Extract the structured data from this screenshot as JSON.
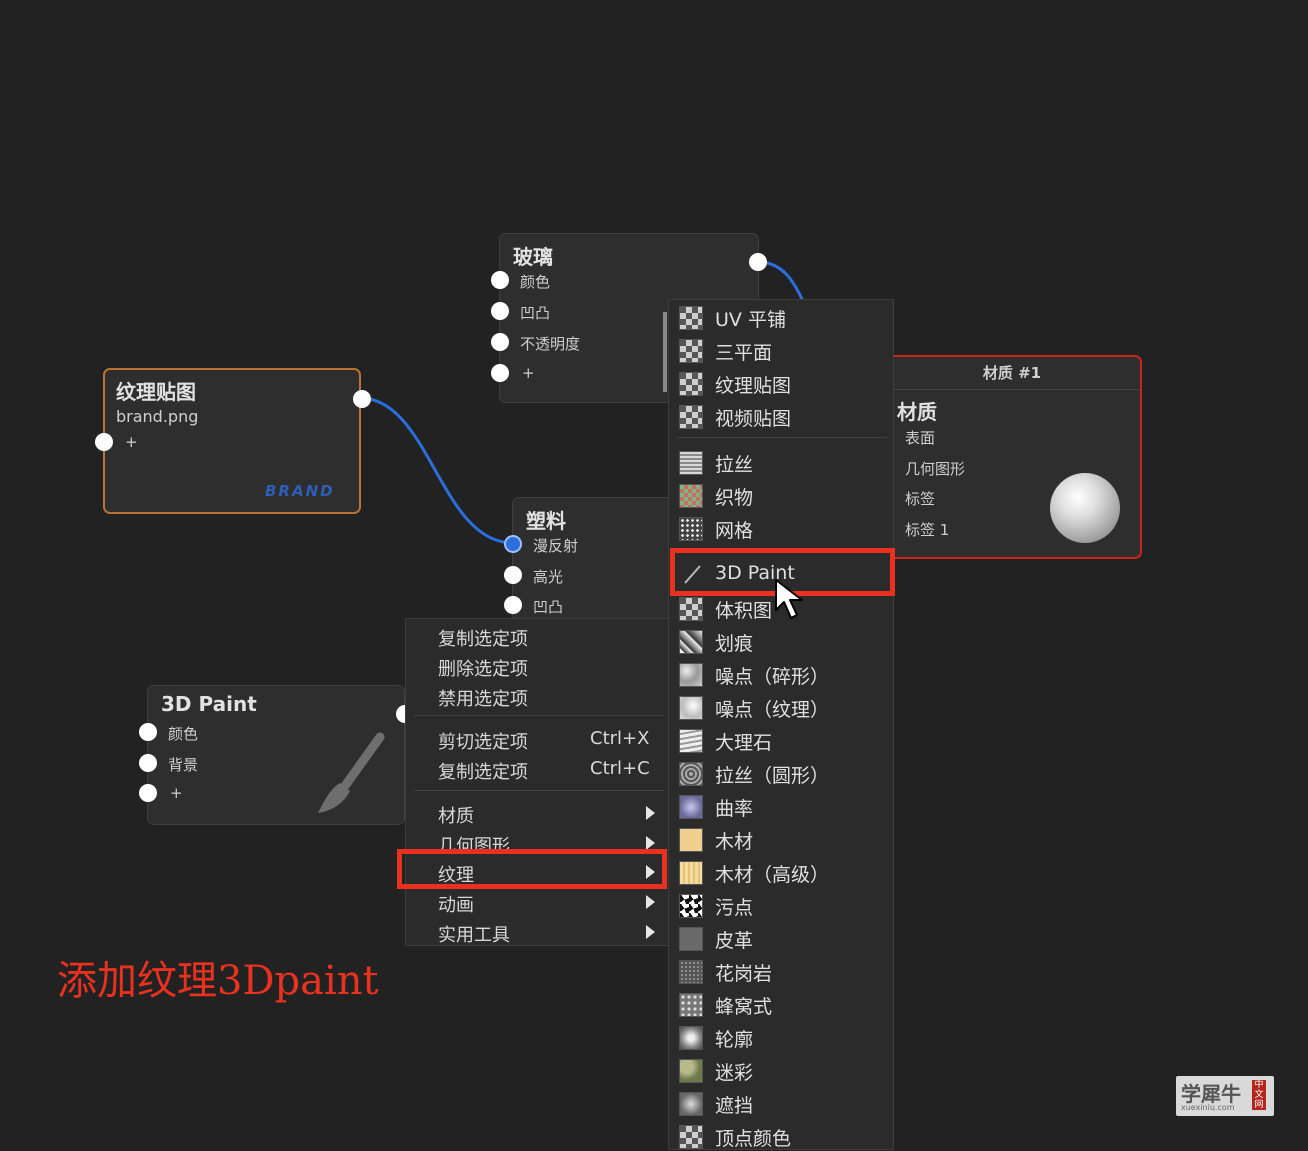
{
  "glass_node": {
    "title": "玻璃",
    "ports": [
      "颜色",
      "凹凸",
      "不透明度",
      "+"
    ]
  },
  "texture_node": {
    "title": "纹理贴图",
    "filename": "brand.png",
    "add": "+",
    "thumbnail_text": "BRAND"
  },
  "plastic_node": {
    "title": "塑料",
    "ports": [
      "漫反射",
      "高光",
      "凹凸"
    ]
  },
  "paint_node": {
    "title": "3D Paint",
    "ports": [
      "颜色",
      "背景",
      "+"
    ]
  },
  "material_node": {
    "header": "材质 #1",
    "title": "材质",
    "ports": [
      "表面",
      "几何图形",
      "标签",
      "标签 1"
    ]
  },
  "context_menu": {
    "group1": [
      "复制选定项",
      "删除选定项",
      "禁用选定项"
    ],
    "group2": [
      {
        "label": "剪切选定项",
        "shortcut": "Ctrl+X"
      },
      {
        "label": "复制选定项",
        "shortcut": "Ctrl+C"
      }
    ],
    "group3": [
      "材质",
      "几何图形",
      "纹理",
      "动画",
      "实用工具"
    ],
    "highlighted": "纹理"
  },
  "texture_menu": {
    "group1": [
      "UV 平铺",
      "三平面",
      "纹理贴图",
      "视频贴图"
    ],
    "group2": [
      "拉丝",
      "织物",
      "网格"
    ],
    "group3": [
      "3D Paint",
      "体积图",
      "划痕",
      "噪点（碎形）",
      "噪点（纹理）",
      "大理石",
      "拉丝（圆形）",
      "曲率",
      "木材",
      "木材（高级）",
      "污点",
      "皮革",
      "花岗岩",
      "蜂窝式",
      "轮廓",
      "迷彩",
      "遮挡",
      "顶点颜色"
    ],
    "highlighted": "3D Paint"
  },
  "annotation": "添加纹理3Dpaint",
  "watermark": {
    "main": "学犀牛",
    "side": "中文网",
    "url": "xuexiniu.com"
  },
  "colors": {
    "accent_red": "#e8321f",
    "wire_blue": "#2a6fdc",
    "material_border": "#c8261c",
    "texture_border": "#b8733a"
  }
}
